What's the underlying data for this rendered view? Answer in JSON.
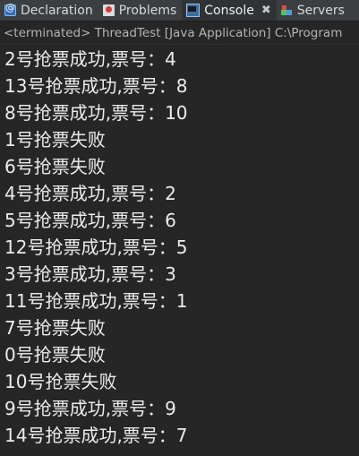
{
  "tabs": [
    {
      "label": "Declaration",
      "icon": "declaration-icon"
    },
    {
      "label": "Problems",
      "icon": "problems-icon"
    },
    {
      "label": "Console",
      "icon": "console-icon",
      "close": "✖"
    },
    {
      "label": "Servers",
      "icon": "servers-icon"
    }
  ],
  "status_line": "<terminated> ThreadTest [Java Application] C:\\Program",
  "console_lines": [
    "2号抢票成功,票号：4",
    "13号抢票成功,票号：8",
    "8号抢票成功,票号：10",
    "1号抢票失败",
    "6号抢票失败",
    "4号抢票成功,票号：2",
    "5号抢票成功,票号：6",
    "12号抢票成功,票号：5",
    "3号抢票成功,票号：3",
    "11号抢票成功,票号：1",
    "7号抢票失败",
    "0号抢票失败",
    "10号抢票失败",
    "9号抢票成功,票号：9",
    "14号抢票成功,票号：7"
  ],
  "colors": {
    "background": "#262626",
    "tabbar": "#3b3f41",
    "text": "#ececec",
    "status_text": "#b4b4b4"
  }
}
